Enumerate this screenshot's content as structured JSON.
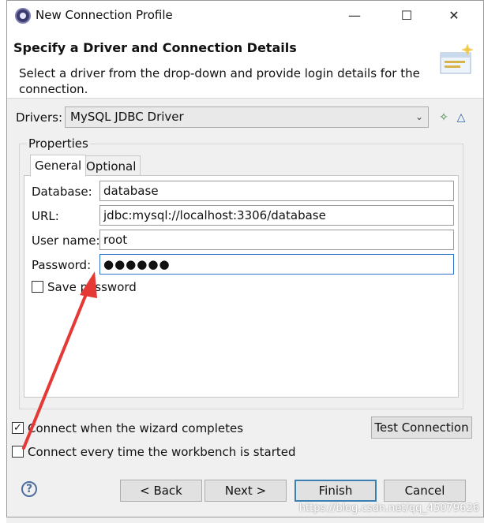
{
  "window": {
    "title": "New Connection Profile"
  },
  "wizard": {
    "heading": "Specify a Driver and Connection Details",
    "description": "Select a driver from the drop-down and provide login details for the connection."
  },
  "drivers": {
    "label": "Drivers:",
    "selected": "MySQL JDBC Driver"
  },
  "properties": {
    "group_label": "Properties",
    "tabs": [
      "General",
      "Optional"
    ],
    "database_label": "Database:",
    "database_value": "database",
    "url_label": "URL:",
    "url_value": "jdbc:mysql://localhost:3306/database",
    "username_label": "User name:",
    "username_value": "root",
    "password_label": "Password:",
    "password_value": "●●●●●●",
    "save_password_label": "Save password"
  },
  "options": {
    "connect_on_complete_label": "Connect when the wizard completes",
    "connect_on_complete_checked": true,
    "connect_on_start_label": "Connect every time the workbench is started",
    "connect_on_start_checked": false
  },
  "buttons": {
    "test_connection": "Test Connection",
    "back": "< Back",
    "next": "Next >",
    "finish": "Finish",
    "cancel": "Cancel"
  },
  "watermark": "https://blog.csdn.net/qq_45079626",
  "colors": {
    "annotation_arrow": "#e53935",
    "focus": "#2a73c9"
  }
}
